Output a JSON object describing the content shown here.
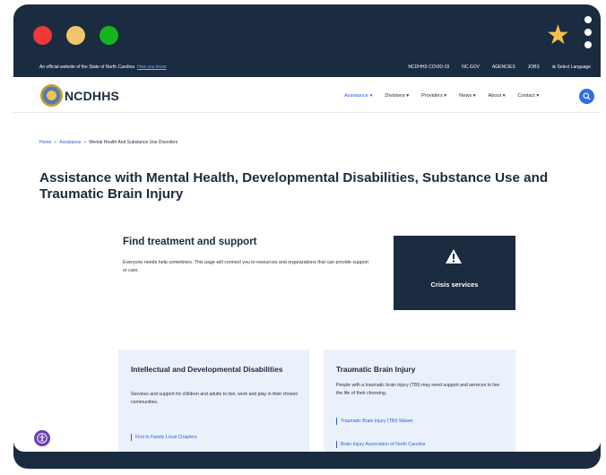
{
  "gov_bar": {
    "official_text": "An official website of the State of North Carolina",
    "how_you_know": "How you know",
    "links": [
      "NCDHHS COVID-19",
      "NC.GOV",
      "AGENCIES",
      "JOBS",
      "Select Language"
    ]
  },
  "header": {
    "logo_text": "NCDHHS",
    "nav": [
      {
        "label": "Assistance ▾"
      },
      {
        "label": "Divisions ▾"
      },
      {
        "label": "Providers ▾"
      },
      {
        "label": "News ▾"
      },
      {
        "label": "About ▾"
      },
      {
        "label": "Contact ▾"
      }
    ]
  },
  "breadcrumb": {
    "home": "Home",
    "assistance": "Assistance",
    "current": "Mental Health And Substance Use Disorders",
    "separator": ">"
  },
  "main": {
    "title": "Assistance with Mental Health, Developmental Disabilities, Substance Use and Traumatic Brain Injury",
    "find_title": "Find treatment and support",
    "find_desc": "Everyone needs help sometimes. This page will connect you to resources and organizations that can provide support or care.",
    "crisis_label": "Crisis services"
  },
  "cards": {
    "idd": {
      "title": "Intellectual and Developmental Disabilities",
      "desc": "Services and support for children and adults to live, work and play in their chosen communities.",
      "links": [
        "First in Family Local Chapters"
      ]
    },
    "tbi": {
      "title": "Traumatic Brain Injury",
      "desc": "People with a traumatic brain injury (TBI) may need support and services to live the life of their choosing.",
      "links": [
        "Traumatic Brain Injury (TBI) Waiver",
        "Brain Injury Association of North Carolina"
      ]
    }
  },
  "icons": {
    "star": "star-icon",
    "menu": "kebab-menu-icon",
    "search": "search-icon",
    "warning": "warning-icon",
    "accessibility": "accessibility-icon",
    "globe": "globe-icon"
  },
  "colors": {
    "navy": "#1b2b40",
    "link_blue": "#2a5fd6",
    "card_bg": "#eaf1fb",
    "search_blue": "#2f6fe3",
    "star": "#f3c04a"
  }
}
